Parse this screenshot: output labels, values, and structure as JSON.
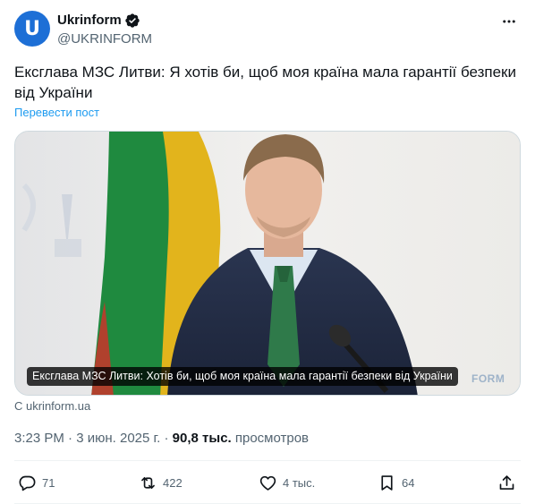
{
  "header": {
    "avatar_glyph": "U",
    "display_name": "Ukrinform",
    "handle": "@UKRINFORM",
    "more_icon": "more-icon"
  },
  "tweet": {
    "text": "Ексглава МЗС Литви: Я хотів би, щоб моя країна мала гарантії безпеки від України",
    "translate_label": "Перевести пост"
  },
  "media": {
    "caption": "Ексглава МЗС Литви: Хотів би, щоб моя країна мала гарантії безпеки від України",
    "watermark": "FORM"
  },
  "source": "С ukrinform.ua",
  "meta": {
    "time": "3:23 PM",
    "separator": "·",
    "date": "3 июн. 2025 г.",
    "views_count": "90,8 тыс.",
    "views_label": "просмотров"
  },
  "actions": {
    "replies": "71",
    "reposts": "422",
    "likes": "4 тыс.",
    "bookmarks": "64"
  },
  "colors": {
    "accent": "#1d9bf0",
    "secondary_text": "#536471",
    "avatar_bg": "#1d6fd6"
  }
}
